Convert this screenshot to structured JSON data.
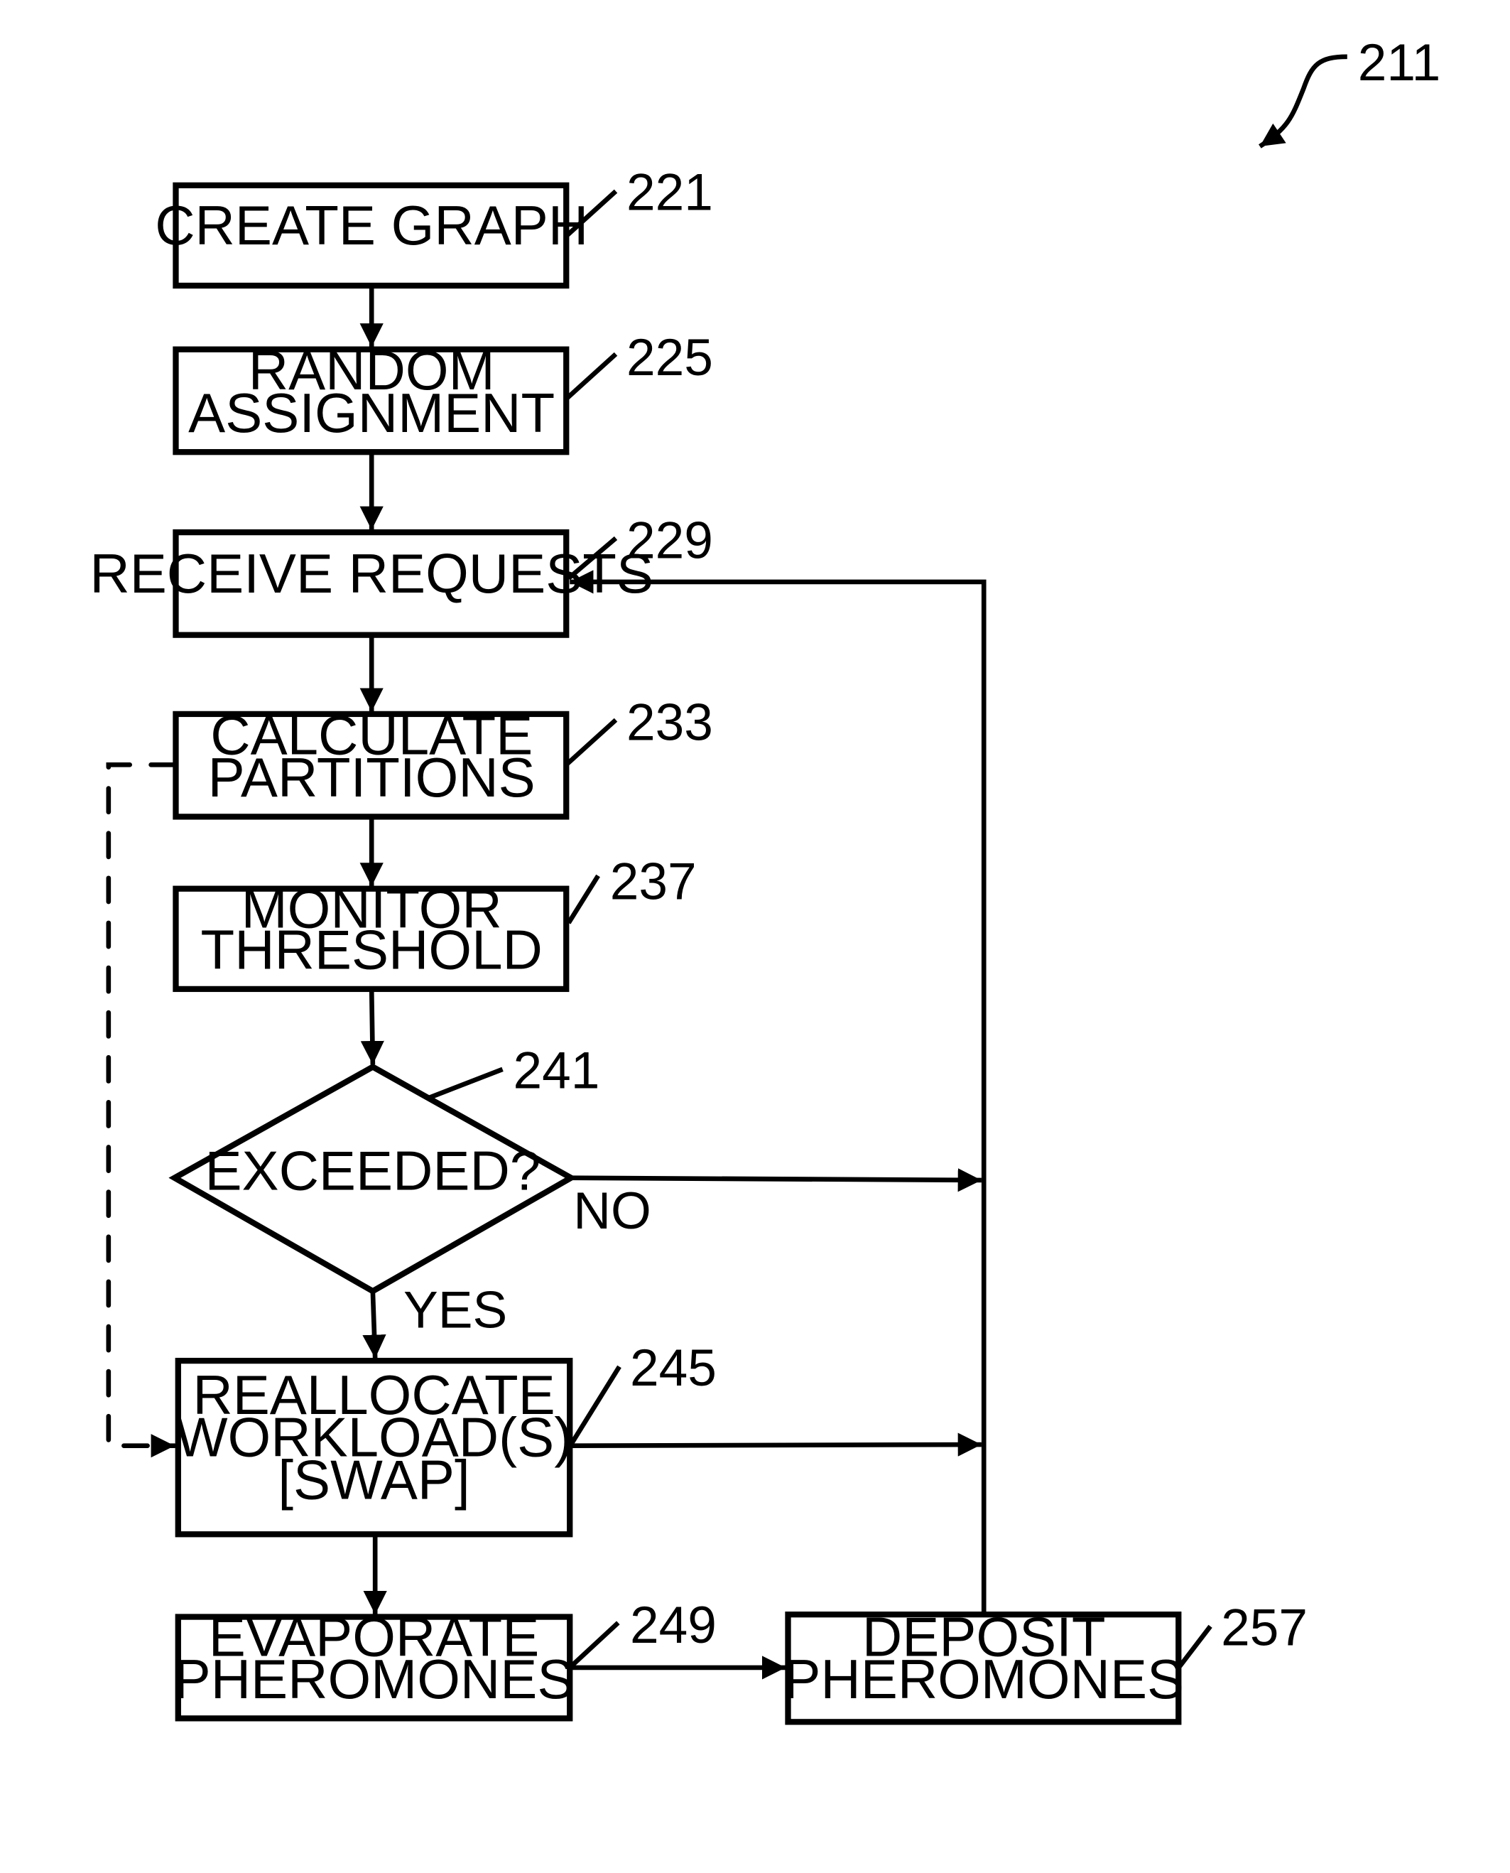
{
  "figure": {
    "ref": "211",
    "nodes": {
      "create_graph": {
        "ref": "221",
        "lines": [
          "CREATE GRAPH"
        ]
      },
      "random_assignment": {
        "ref": "225",
        "lines": [
          "RANDOM",
          "ASSIGNMENT"
        ]
      },
      "receive_requests": {
        "ref": "229",
        "lines": [
          "RECEIVE REQUESTS"
        ]
      },
      "calculate_partitions": {
        "ref": "233",
        "lines": [
          "CALCULATE",
          "PARTITIONS"
        ]
      },
      "monitor_threshold": {
        "ref": "237",
        "lines": [
          "MONITOR",
          "THRESHOLD"
        ]
      },
      "exceeded": {
        "ref": "241",
        "lines": [
          "EXCEEDED?"
        ]
      },
      "reallocate": {
        "ref": "245",
        "lines": [
          "REALLOCATE",
          "WORKLOAD(S)",
          "[SWAP]"
        ]
      },
      "evaporate": {
        "ref": "249",
        "lines": [
          "EVAPORATE",
          "PHEROMONES"
        ]
      },
      "deposit": {
        "ref": "257",
        "lines": [
          "DEPOSIT",
          "PHEROMONES"
        ]
      }
    },
    "edges": {
      "no_label": "NO",
      "yes_label": "YES"
    }
  }
}
